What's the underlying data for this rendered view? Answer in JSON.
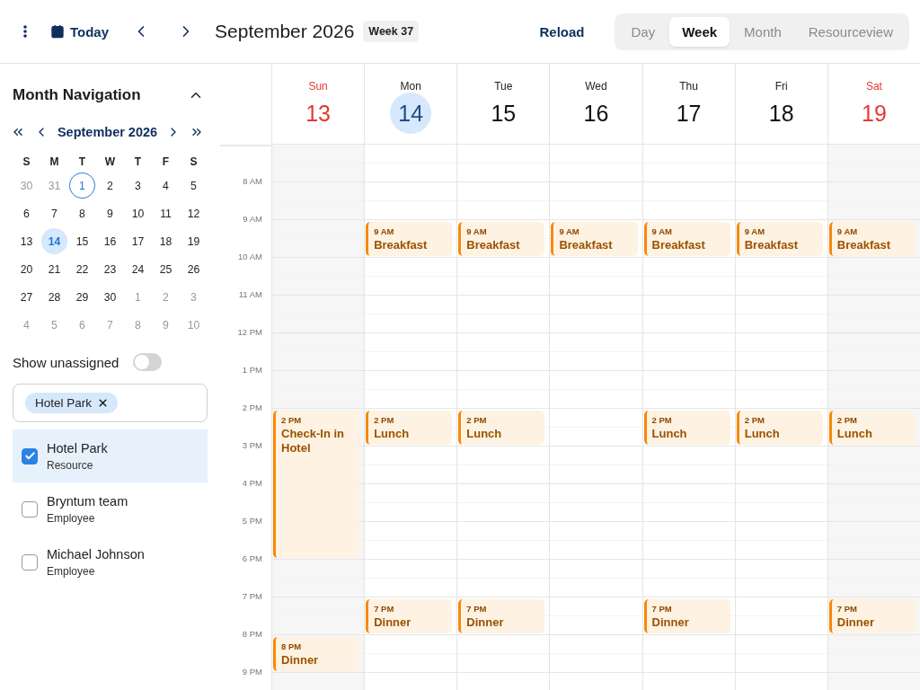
{
  "toolbar": {
    "today_label": "Today",
    "title": "September 2026",
    "week_badge": "Week 37",
    "reload_label": "Reload",
    "views": [
      {
        "label": "Day",
        "selected": false
      },
      {
        "label": "Week",
        "selected": true
      },
      {
        "label": "Month",
        "selected": false
      },
      {
        "label": "Resourceview",
        "selected": false
      }
    ]
  },
  "sidebar": {
    "title": "Month Navigation",
    "expanded": true,
    "mini_calendar": {
      "month": "September 2026",
      "weekdays": [
        "S",
        "M",
        "T",
        "W",
        "T",
        "F",
        "S"
      ],
      "days": [
        {
          "day": "30",
          "other_month": true,
          "today": false,
          "selected": false
        },
        {
          "day": "31",
          "other_month": true,
          "today": false,
          "selected": false
        },
        {
          "day": "1",
          "other_month": false,
          "today": true,
          "selected": false
        },
        {
          "day": "2",
          "other_month": false,
          "today": false,
          "selected": false
        },
        {
          "day": "3",
          "other_month": false,
          "today": false,
          "selected": false
        },
        {
          "day": "4",
          "other_month": false,
          "today": false,
          "selected": false
        },
        {
          "day": "5",
          "other_month": false,
          "today": false,
          "selected": false
        },
        {
          "day": "6",
          "other_month": false,
          "today": false,
          "selected": false
        },
        {
          "day": "7",
          "other_month": false,
          "today": false,
          "selected": false
        },
        {
          "day": "8",
          "other_month": false,
          "today": false,
          "selected": false
        },
        {
          "day": "9",
          "other_month": false,
          "today": false,
          "selected": false
        },
        {
          "day": "10",
          "other_month": false,
          "today": false,
          "selected": false
        },
        {
          "day": "11",
          "other_month": false,
          "today": false,
          "selected": false
        },
        {
          "day": "12",
          "other_month": false,
          "today": false,
          "selected": false
        },
        {
          "day": "13",
          "other_month": false,
          "today": false,
          "selected": false
        },
        {
          "day": "14",
          "other_month": false,
          "today": false,
          "selected": true
        },
        {
          "day": "15",
          "other_month": false,
          "today": false,
          "selected": false
        },
        {
          "day": "16",
          "other_month": false,
          "today": false,
          "selected": false
        },
        {
          "day": "17",
          "other_month": false,
          "today": false,
          "selected": false
        },
        {
          "day": "18",
          "other_month": false,
          "today": false,
          "selected": false
        },
        {
          "day": "19",
          "other_month": false,
          "today": false,
          "selected": false
        },
        {
          "day": "20",
          "other_month": false,
          "today": false,
          "selected": false
        },
        {
          "day": "21",
          "other_month": false,
          "today": false,
          "selected": false
        },
        {
          "day": "22",
          "other_month": false,
          "today": false,
          "selected": false
        },
        {
          "day": "23",
          "other_month": false,
          "today": false,
          "selected": false
        },
        {
          "day": "24",
          "other_month": false,
          "today": false,
          "selected": false
        },
        {
          "day": "25",
          "other_month": false,
          "today": false,
          "selected": false
        },
        {
          "day": "26",
          "other_month": false,
          "today": false,
          "selected": false
        },
        {
          "day": "27",
          "other_month": false,
          "today": false,
          "selected": false
        },
        {
          "day": "28",
          "other_month": false,
          "today": false,
          "selected": false
        },
        {
          "day": "29",
          "other_month": false,
          "today": false,
          "selected": false
        },
        {
          "day": "30",
          "other_month": false,
          "today": false,
          "selected": false
        },
        {
          "day": "1",
          "other_month": true,
          "today": false,
          "selected": false
        },
        {
          "day": "2",
          "other_month": true,
          "today": false,
          "selected": false
        },
        {
          "day": "3",
          "other_month": true,
          "today": false,
          "selected": false
        },
        {
          "day": "4",
          "other_month": true,
          "today": false,
          "selected": false
        },
        {
          "day": "5",
          "other_month": true,
          "today": false,
          "selected": false
        },
        {
          "day": "6",
          "other_month": true,
          "today": false,
          "selected": false
        },
        {
          "day": "7",
          "other_month": true,
          "today": false,
          "selected": false
        },
        {
          "day": "8",
          "other_month": true,
          "today": false,
          "selected": false
        },
        {
          "day": "9",
          "other_month": true,
          "today": false,
          "selected": false
        },
        {
          "day": "10",
          "other_month": true,
          "today": false,
          "selected": false
        }
      ]
    },
    "show_unassigned": {
      "label": "Show unassigned",
      "on": false
    },
    "filter_tags": [
      {
        "label": "Hotel Park"
      }
    ],
    "resources": [
      {
        "name": "Hotel Park",
        "role": "Resource",
        "checked": true,
        "selected": true
      },
      {
        "name": "Bryntum team",
        "role": "Employee",
        "checked": false,
        "selected": false
      },
      {
        "name": "Michael Johnson",
        "role": "Employee",
        "checked": false,
        "selected": false
      }
    ]
  },
  "week": {
    "hours": [
      "8 AM",
      "9 AM",
      "10 AM",
      "11 AM",
      "12 PM",
      "1 PM",
      "2 PM",
      "3 PM",
      "4 PM",
      "5 PM",
      "6 PM",
      "7 PM",
      "8 PM",
      "9 PM"
    ],
    "days": [
      {
        "name": "Sun",
        "date": "13",
        "weekend": true,
        "selected": false,
        "events": [
          {
            "time": "2 PM",
            "title": "Check-In in Hotel",
            "kind": "stay"
          },
          {
            "time": "8 PM",
            "title": "Dinner",
            "kind": "meal"
          }
        ]
      },
      {
        "name": "Mon",
        "date": "14",
        "weekend": false,
        "selected": true,
        "events": [
          {
            "time": "9 AM",
            "title": "Breakfast",
            "kind": "meal"
          },
          {
            "time": "2 PM",
            "title": "Lunch",
            "kind": "meal"
          },
          {
            "time": "7 PM",
            "title": "Dinner",
            "kind": "meal"
          }
        ]
      },
      {
        "name": "Tue",
        "date": "15",
        "weekend": false,
        "selected": false,
        "events": [
          {
            "time": "9 AM",
            "title": "Breakfast",
            "kind": "meal"
          },
          {
            "time": "2 PM",
            "title": "Lunch",
            "kind": "meal"
          },
          {
            "time": "7 PM",
            "title": "Dinner",
            "kind": "meal"
          }
        ]
      },
      {
        "name": "Wed",
        "date": "16",
        "weekend": false,
        "selected": false,
        "events": [
          {
            "time": "9 AM",
            "title": "Breakfast",
            "kind": "meal"
          }
        ]
      },
      {
        "name": "Thu",
        "date": "17",
        "weekend": false,
        "selected": false,
        "events": [
          {
            "time": "9 AM",
            "title": "Breakfast",
            "kind": "meal"
          },
          {
            "time": "2 PM",
            "title": "Lunch",
            "kind": "meal"
          },
          {
            "time": "7 PM",
            "title": "Dinner",
            "kind": "meal"
          }
        ]
      },
      {
        "name": "Fri",
        "date": "18",
        "weekend": false,
        "selected": false,
        "events": [
          {
            "time": "9 AM",
            "title": "Breakfast",
            "kind": "meal"
          },
          {
            "time": "2 PM",
            "title": "Lunch",
            "kind": "meal"
          }
        ]
      },
      {
        "name": "Sat",
        "date": "19",
        "weekend": true,
        "selected": false,
        "events": [
          {
            "time": "9 AM",
            "title": "Breakfast",
            "kind": "meal"
          },
          {
            "time": "2 PM",
            "title": "Lunch",
            "kind": "meal"
          },
          {
            "time": "7 PM",
            "title": "Dinner",
            "kind": "meal"
          }
        ]
      }
    ]
  }
}
